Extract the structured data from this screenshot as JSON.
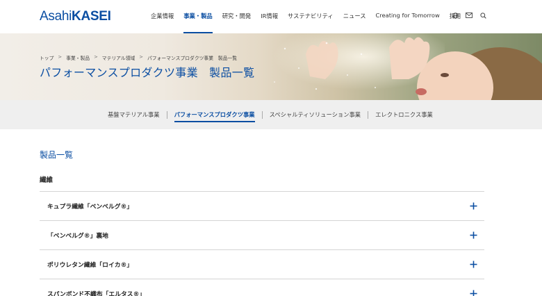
{
  "header": {
    "logo_light": "Asahi",
    "logo_bold": "KASEI",
    "nav": [
      {
        "label": "企業情報",
        "active": false
      },
      {
        "label": "事業・製品",
        "active": true
      },
      {
        "label": "研究・開発",
        "active": false
      },
      {
        "label": "IR情報",
        "active": false
      },
      {
        "label": "サステナビリティ",
        "active": false
      },
      {
        "label": "ニュース",
        "active": false
      },
      {
        "label": "Creating for Tomorrow",
        "active": false
      },
      {
        "label": "採用",
        "active": false
      }
    ],
    "icons": [
      "globe-icon",
      "mail-icon",
      "search-icon"
    ],
    "accent": "#0b4ea2"
  },
  "hero": {
    "breadcrumb": [
      "トップ",
      "事業・製品",
      "マテリアル領域",
      "パフォーマンスプロダクツ事業　製品一覧"
    ],
    "breadcrumb_separator": ">",
    "title": "パフォーマンスプロダクツ事業　製品一覧"
  },
  "subnav": {
    "items": [
      {
        "label": "基盤マテリアル事業",
        "active": false
      },
      {
        "label": "パフォーマンスプロダクツ事業",
        "active": true
      },
      {
        "label": "スペシャルティソリューション事業",
        "active": false
      },
      {
        "label": "エレクトロニクス事業",
        "active": false
      }
    ]
  },
  "main": {
    "section_title": "製品一覧",
    "category": "繊維",
    "products": [
      {
        "label": "キュプラ繊維「ベンベルグ®」"
      },
      {
        "label": "「ベンベルグ®」裏地"
      },
      {
        "label": "ポリウレタン繊維「ロイカ®」"
      },
      {
        "label": "スパンボンド不織布「エルタス®」"
      }
    ]
  }
}
